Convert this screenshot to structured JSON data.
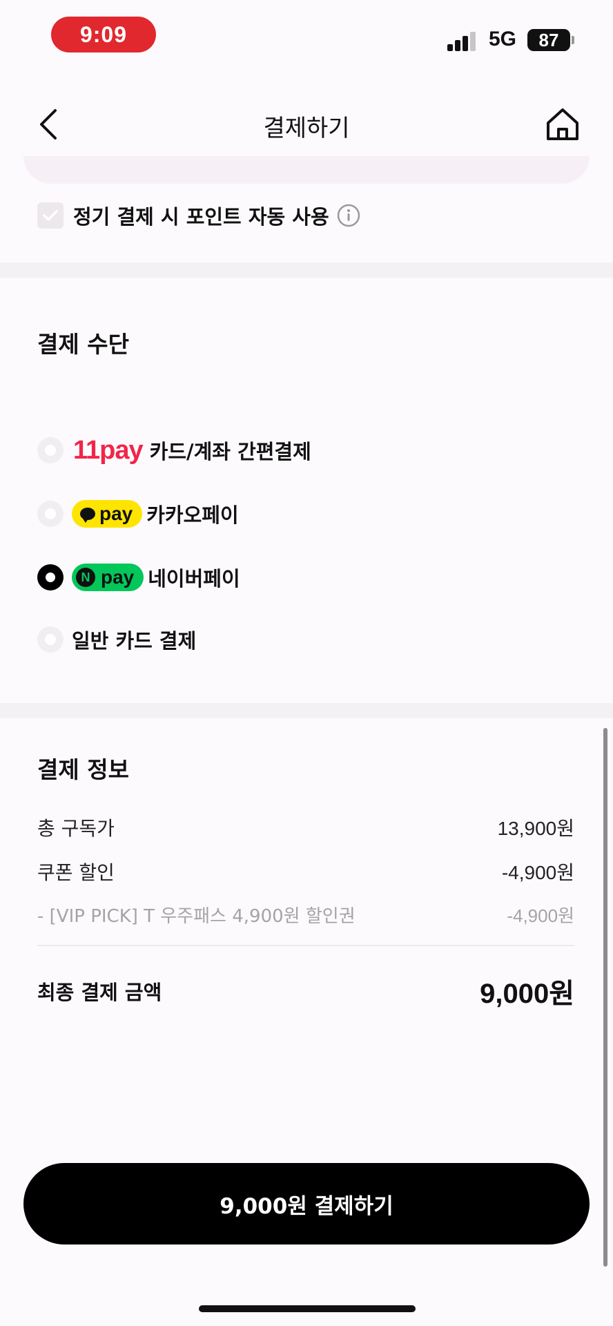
{
  "status_bar": {
    "time": "9:09",
    "network": "5G",
    "battery": "87"
  },
  "header": {
    "title": "결제하기"
  },
  "auto_point": {
    "label": "정기 결제 시 포인트 자동 사용",
    "checked": true
  },
  "payment_method": {
    "title": "결제 수단",
    "options": [
      {
        "logo_text": "11pay",
        "label": "카드/계좌 간편결제",
        "selected": false
      },
      {
        "logo_text": "pay",
        "label": "카카오페이",
        "selected": false
      },
      {
        "logo_text": "pay",
        "label": "네이버페이",
        "selected": true
      },
      {
        "logo_text": "",
        "label": "일반 카드 결제",
        "selected": false
      }
    ]
  },
  "payment_info": {
    "title": "결제 정보",
    "rows": [
      {
        "label": "총 구독가",
        "value": "13,900원"
      },
      {
        "label": "쿠폰 할인",
        "value": "-4,900원"
      },
      {
        "label": "- [VIP PICK] T 우주패스 4,900원 할인권",
        "value": "-4,900원"
      }
    ],
    "total_label": "최종 결제 금액",
    "total_value": "9,000원"
  },
  "cta": {
    "label": "9,000원 결제하기"
  },
  "colors": {
    "accent": "#000000",
    "time_pill": "#e0282e",
    "kakao": "#fee500",
    "naver": "#03c75a",
    "eleven_pay": "#f1254a"
  }
}
